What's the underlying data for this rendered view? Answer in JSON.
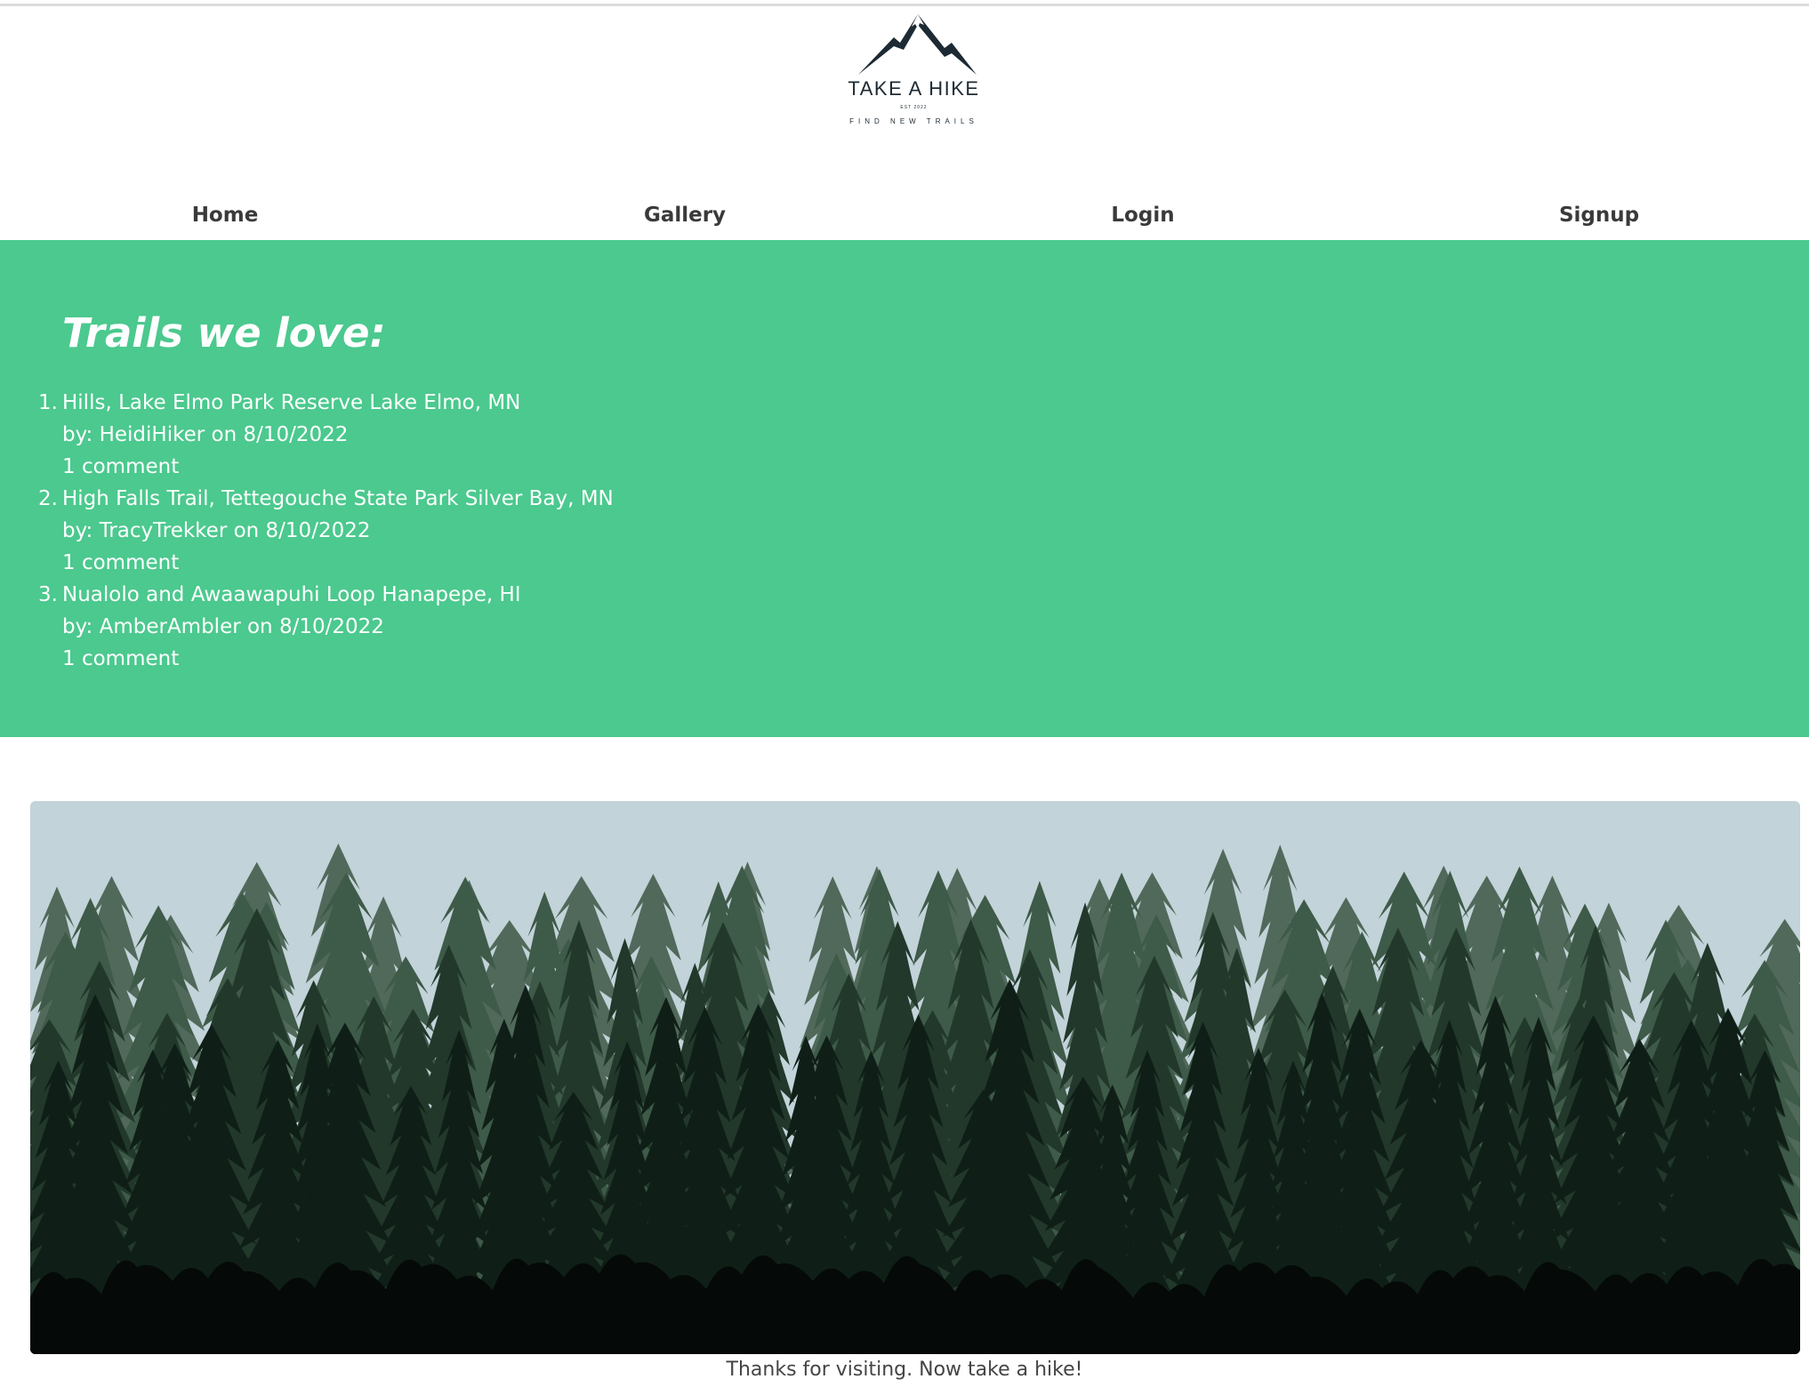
{
  "header": {
    "logo": {
      "title": "TAKE A HIKE",
      "established": "EST 2022",
      "tagline": "FIND NEW TRAILS",
      "icon": "mountain-icon"
    },
    "nav": [
      {
        "label": "Home"
      },
      {
        "label": "Gallery"
      },
      {
        "label": "Login"
      },
      {
        "label": "Signup"
      }
    ]
  },
  "hero": {
    "heading": "Trails we love:",
    "trails": [
      {
        "number": "1.",
        "name": "Hills, Lake Elmo Park Reserve Lake Elmo, MN",
        "byline": "by: HeidiHiker on 8/10/2022",
        "comments": "1 comment"
      },
      {
        "number": "2.",
        "name": "High Falls Trail, Tettegouche State Park Silver Bay, MN",
        "byline": "by: TracyTrekker on 8/10/2022",
        "comments": "1 comment"
      },
      {
        "number": "3.",
        "name": "Nualolo and Awaawapuhi Loop Hanapepe, HI",
        "byline": "by: AmberAmbler on 8/10/2022",
        "comments": "1 comment"
      }
    ]
  },
  "colors": {
    "hero_background": "#4bc98e",
    "nav_text": "#3a3a3a",
    "sky": "#c2d3d9"
  },
  "footer": {
    "text": "Thanks for visiting. Now take a hike!"
  }
}
